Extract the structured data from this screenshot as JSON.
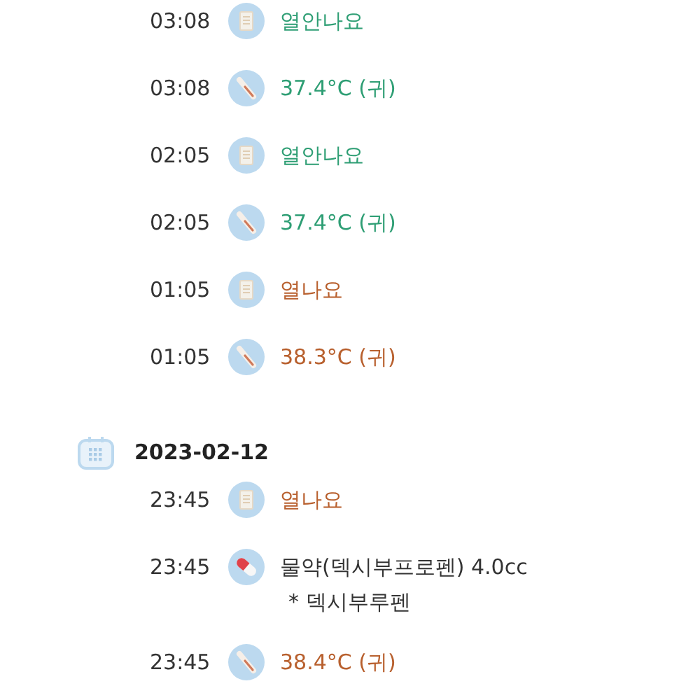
{
  "days": [
    {
      "entries": [
        {
          "time": "03:08",
          "kind": "note",
          "text": "열안나요",
          "color": "#2e9e74"
        },
        {
          "time": "03:08",
          "kind": "temperature",
          "text": "37.4°C (귀)",
          "color": "#2e9e74"
        },
        {
          "time": "02:05",
          "kind": "note",
          "text": "열안나요",
          "color": "#2e9e74"
        },
        {
          "time": "02:05",
          "kind": "temperature",
          "text": "37.4°C (귀)",
          "color": "#2e9e74"
        },
        {
          "time": "01:05",
          "kind": "note",
          "text": "열나요",
          "color": "#b8602e"
        },
        {
          "time": "01:05",
          "kind": "temperature",
          "text": "38.3°C (귀)",
          "color": "#b8602e"
        }
      ]
    },
    {
      "date": "2023-02-12",
      "entries": [
        {
          "time": "23:45",
          "kind": "note",
          "text": "열나요",
          "color": "#b8602e"
        },
        {
          "time": "23:45",
          "kind": "medicine",
          "text": "물약(덱시부프로펜) 4.0cc",
          "note": "* 덱시부루펜",
          "color": "#333333"
        },
        {
          "time": "23:45",
          "kind": "temperature",
          "text": "38.4°C (귀)",
          "color": "#b8602e"
        }
      ]
    }
  ]
}
